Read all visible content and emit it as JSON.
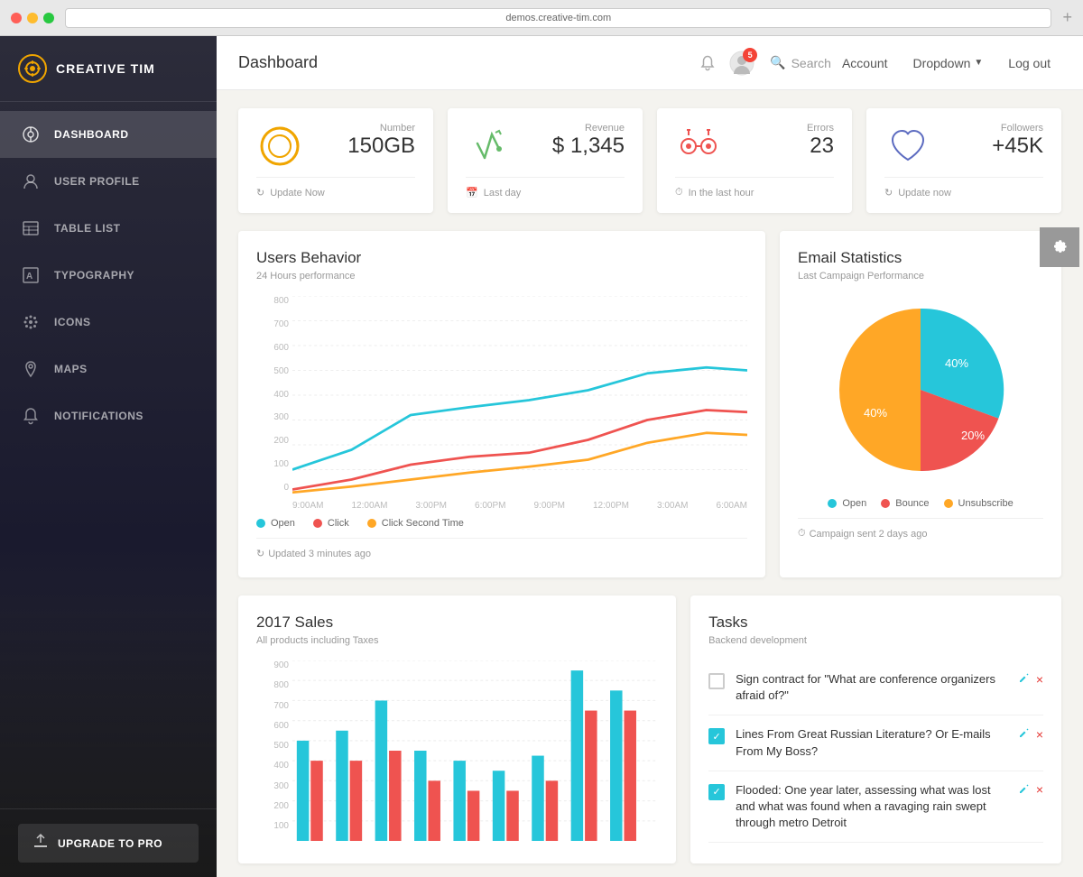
{
  "browser": {
    "url": "demos.creative-tim.com"
  },
  "sidebar": {
    "logo_icon": "⚙",
    "logo_text": "CREATIVE TIM",
    "nav_items": [
      {
        "id": "dashboard",
        "label": "DASHBOARD",
        "icon": "◎",
        "active": true
      },
      {
        "id": "user-profile",
        "label": "USER PROFILE",
        "icon": "👤",
        "active": false
      },
      {
        "id": "table-list",
        "label": "TABLE LIST",
        "icon": "📋",
        "active": false
      },
      {
        "id": "typography",
        "label": "TYPOGRAPHY",
        "icon": "🔠",
        "active": false
      },
      {
        "id": "icons",
        "label": "ICONS",
        "icon": "✳",
        "active": false
      },
      {
        "id": "maps",
        "label": "MAPS",
        "icon": "📍",
        "active": false
      },
      {
        "id": "notifications",
        "label": "NOTIFICATIONS",
        "icon": "🔔",
        "active": false
      }
    ],
    "upgrade_label": "UPGRADE TO PRO",
    "upgrade_icon": "⬆"
  },
  "header": {
    "title": "Dashboard",
    "notification_count": "5",
    "search_placeholder": "Search",
    "nav": {
      "account": "Account",
      "dropdown": "Dropdown",
      "logout": "Log out"
    }
  },
  "stats": [
    {
      "label": "Number",
      "value": "150GB",
      "footer": "Update Now",
      "icon_type": "circle-chart",
      "icon_color": "#f0a500"
    },
    {
      "label": "Revenue",
      "value": "$ 1,345",
      "footer": "Last day",
      "icon_type": "flash",
      "icon_color": "#66bb6a"
    },
    {
      "label": "Errors",
      "value": "23",
      "footer": "In the last hour",
      "icon_type": "nodes",
      "icon_color": "#ef5350"
    },
    {
      "label": "Followers",
      "value": "+45K",
      "footer": "Update now",
      "icon_type": "heart",
      "icon_color": "#5c6bc0"
    }
  ],
  "users_behavior": {
    "title": "Users Behavior",
    "subtitle": "24 Hours performance",
    "y_labels": [
      "800",
      "700",
      "600",
      "500",
      "400",
      "300",
      "200",
      "100",
      "0"
    ],
    "x_labels": [
      "9:00AM",
      "12:00AM",
      "3:00PM",
      "6:00PM",
      "9:00PM",
      "12:00PM",
      "3:00AM",
      "6:00AM"
    ],
    "legend": [
      {
        "label": "Open",
        "color": "#26c6da"
      },
      {
        "label": "Click",
        "color": "#ef5350"
      },
      {
        "label": "Click Second Time",
        "color": "#ffa726"
      }
    ],
    "footer": "Updated 3 minutes ago"
  },
  "email_statistics": {
    "title": "Email Statistics",
    "subtitle": "Last Campaign Performance",
    "segments": [
      {
        "label": "Open",
        "value": 40,
        "color": "#26c6da"
      },
      {
        "label": "Bounce",
        "value": 20,
        "color": "#ef5350"
      },
      {
        "label": "Unsubscribe",
        "value": 40,
        "color": "#ffa726"
      }
    ],
    "footer": "Campaign sent 2 days ago"
  },
  "sales_2017": {
    "title": "2017 Sales",
    "subtitle": "All products including Taxes",
    "y_labels": [
      "900",
      "800",
      "700",
      "600",
      "500",
      "400",
      "300",
      "200",
      "100"
    ],
    "colors": [
      "#26c6da",
      "#ef5350"
    ]
  },
  "tasks": {
    "title": "Tasks",
    "subtitle": "Backend development",
    "items": [
      {
        "text": "Sign contract for \"What are conference organizers afraid of?\"",
        "checked": false
      },
      {
        "text": "Lines From Great Russian Literature? Or E-mails From My Boss?",
        "checked": true
      },
      {
        "text": "Flooded: One year later, assessing what was lost and what was found when a ravaging rain swept through metro Detroit",
        "checked": true
      }
    ]
  }
}
